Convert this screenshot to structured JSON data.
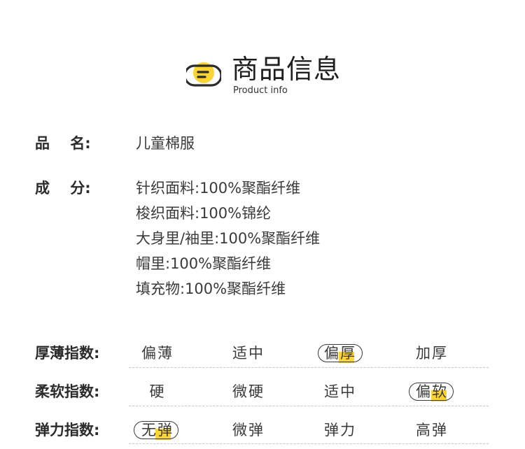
{
  "header": {
    "title": "商品信息",
    "subtitle": "Product info",
    "icon": "document-lines-icon",
    "accent": "#fcd535"
  },
  "name_row": {
    "label": "品    名:",
    "value": "儿童棉服"
  },
  "composition": {
    "label": "成    分:",
    "lines": [
      "针织面料:100%聚酯纤维",
      "梭织面料:100%锦纶",
      "大身里/袖里:100%聚酯纤维",
      "帽里:100%聚酯纤维",
      "填充物:100%聚酯纤维"
    ]
  },
  "indices": [
    {
      "label": "厚薄指数:",
      "options": [
        "偏薄",
        "适中",
        "偏厚",
        "加厚"
      ],
      "selected": "偏厚"
    },
    {
      "label": "柔软指数:",
      "options": [
        "硬",
        "微硬",
        "适中",
        "偏软"
      ],
      "selected": "偏软"
    },
    {
      "label": "弹力指数:",
      "options": [
        "无弹",
        "微弹",
        "弹力",
        "高弹"
      ],
      "selected": "无弹"
    }
  ]
}
